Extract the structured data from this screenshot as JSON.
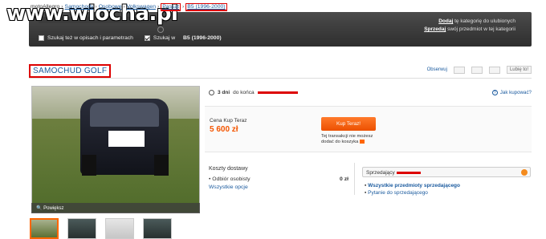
{
  "watermark": "www.wiocha.pl",
  "breadcrumb": [
    "motoAllegro",
    "Samochody",
    "Osobowe",
    "Volkswagen",
    "Passat",
    "B5 (1996-2000)"
  ],
  "search": {
    "check_descriptions": "Szukaj też w opisach i parametrach",
    "check_category": "Szukaj w",
    "check_category_value": "B5 (1996-2000)"
  },
  "top_right": {
    "add_label": "Dodaj",
    "add_text": "tę kategorię do ulubionych",
    "sell_label": "Sprzedaj",
    "sell_text": "swój przedmiot w tej kategorii"
  },
  "title": "SAMOCHUD GOLF",
  "actions": {
    "watch": "Obserwuj",
    "like": "Lubię to!"
  },
  "timer": {
    "days": "3 dni",
    "text": "do końca"
  },
  "help": "Jak kupować?",
  "price": {
    "label": "Cena Kup Teraz",
    "value": "5 600 zł"
  },
  "buynow": {
    "label": "Kup Teraz!",
    "note": "Tej transakcji nie możesz dodać do koszyka"
  },
  "zoom_label": "Powiększ",
  "shipping": {
    "title": "Koszty dostawy",
    "pickup": "Odbiór osobisty",
    "pickup_cost": "0 zł",
    "all_options": "Wszystkie opcje"
  },
  "seller": {
    "label": "Sprzedający",
    "link_items": "Wszystkie przedmioty sprzedającego",
    "link_ask": "Pytanie do sprzedającego"
  }
}
